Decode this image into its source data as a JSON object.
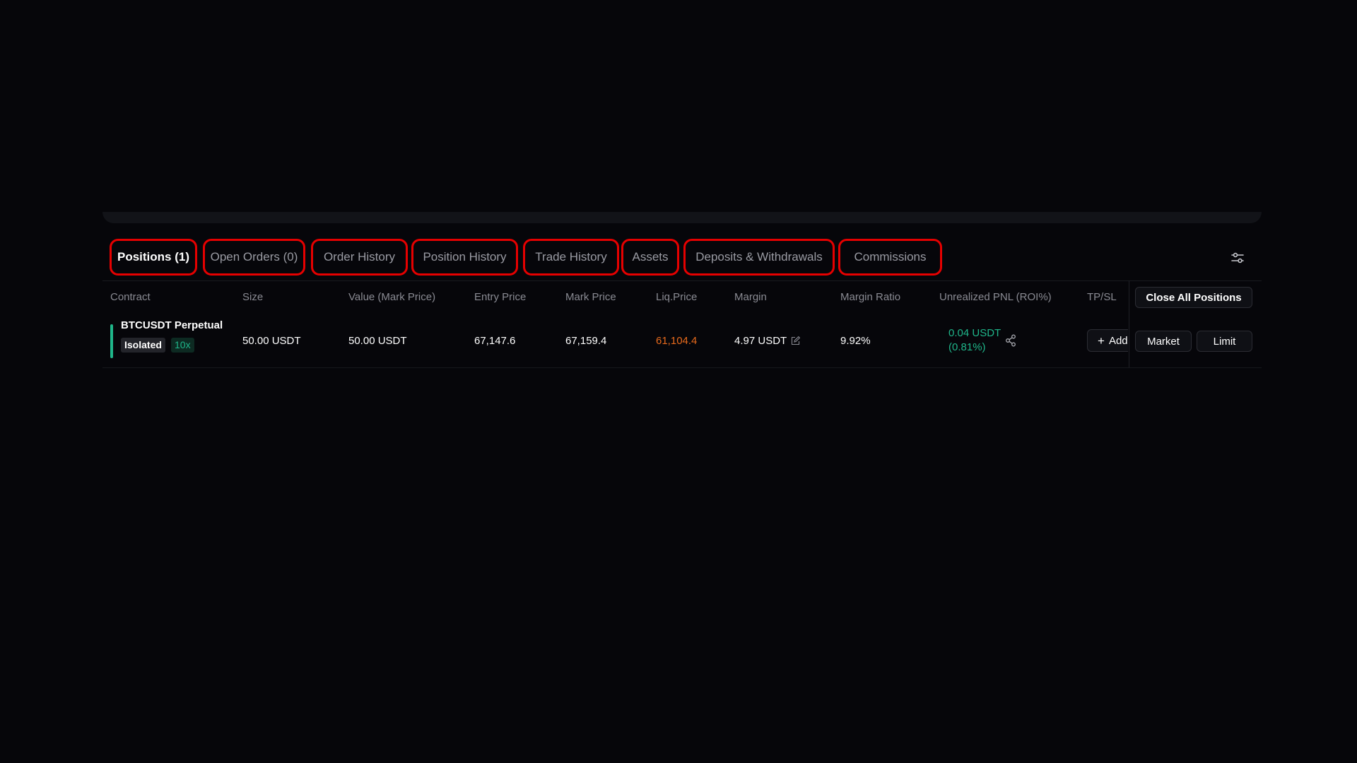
{
  "tabs": [
    {
      "label": "Positions (1)",
      "active": true
    },
    {
      "label": "Open Orders (0)",
      "active": false
    },
    {
      "label": "Order History",
      "active": false
    },
    {
      "label": "Position History",
      "active": false
    },
    {
      "label": "Trade History",
      "active": false
    },
    {
      "label": "Assets",
      "active": false
    },
    {
      "label": "Deposits & Withdrawals",
      "active": false
    },
    {
      "label": "Commissions",
      "active": false
    }
  ],
  "table": {
    "headers": {
      "contract": "Contract",
      "size": "Size",
      "value": "Value (Mark Price)",
      "entry": "Entry Price",
      "mark": "Mark Price",
      "liq": "Liq.Price",
      "margin": "Margin",
      "margin_ratio": "Margin Ratio",
      "pnl": "Unrealized PNL (ROI%)",
      "tpsl": "TP/SL"
    },
    "close_all_label": "Close All Positions",
    "row": {
      "contract": "BTCUSDT Perpetual",
      "margin_mode": "Isolated",
      "leverage": "10x",
      "size": "50.00 USDT",
      "value": "50.00 USDT",
      "entry_price": "67,147.6",
      "mark_price": "67,159.4",
      "liq_price": "61,104.4",
      "margin": "4.97 USDT",
      "margin_ratio": "9.92%",
      "pnl": "0.04 USDT",
      "roi": "(0.81%)",
      "tpsl_add_label": "Add",
      "market_label": "Market",
      "limit_label": "Limit"
    }
  },
  "colors": {
    "background": "#06060a",
    "positive": "#1fb68a",
    "liq_price": "#e86a1c",
    "highlight_border": "#e60000"
  },
  "icons": {
    "settings": "sliders-icon",
    "share": "share-icon",
    "edit": "edit-icon",
    "add": "plus-icon"
  }
}
